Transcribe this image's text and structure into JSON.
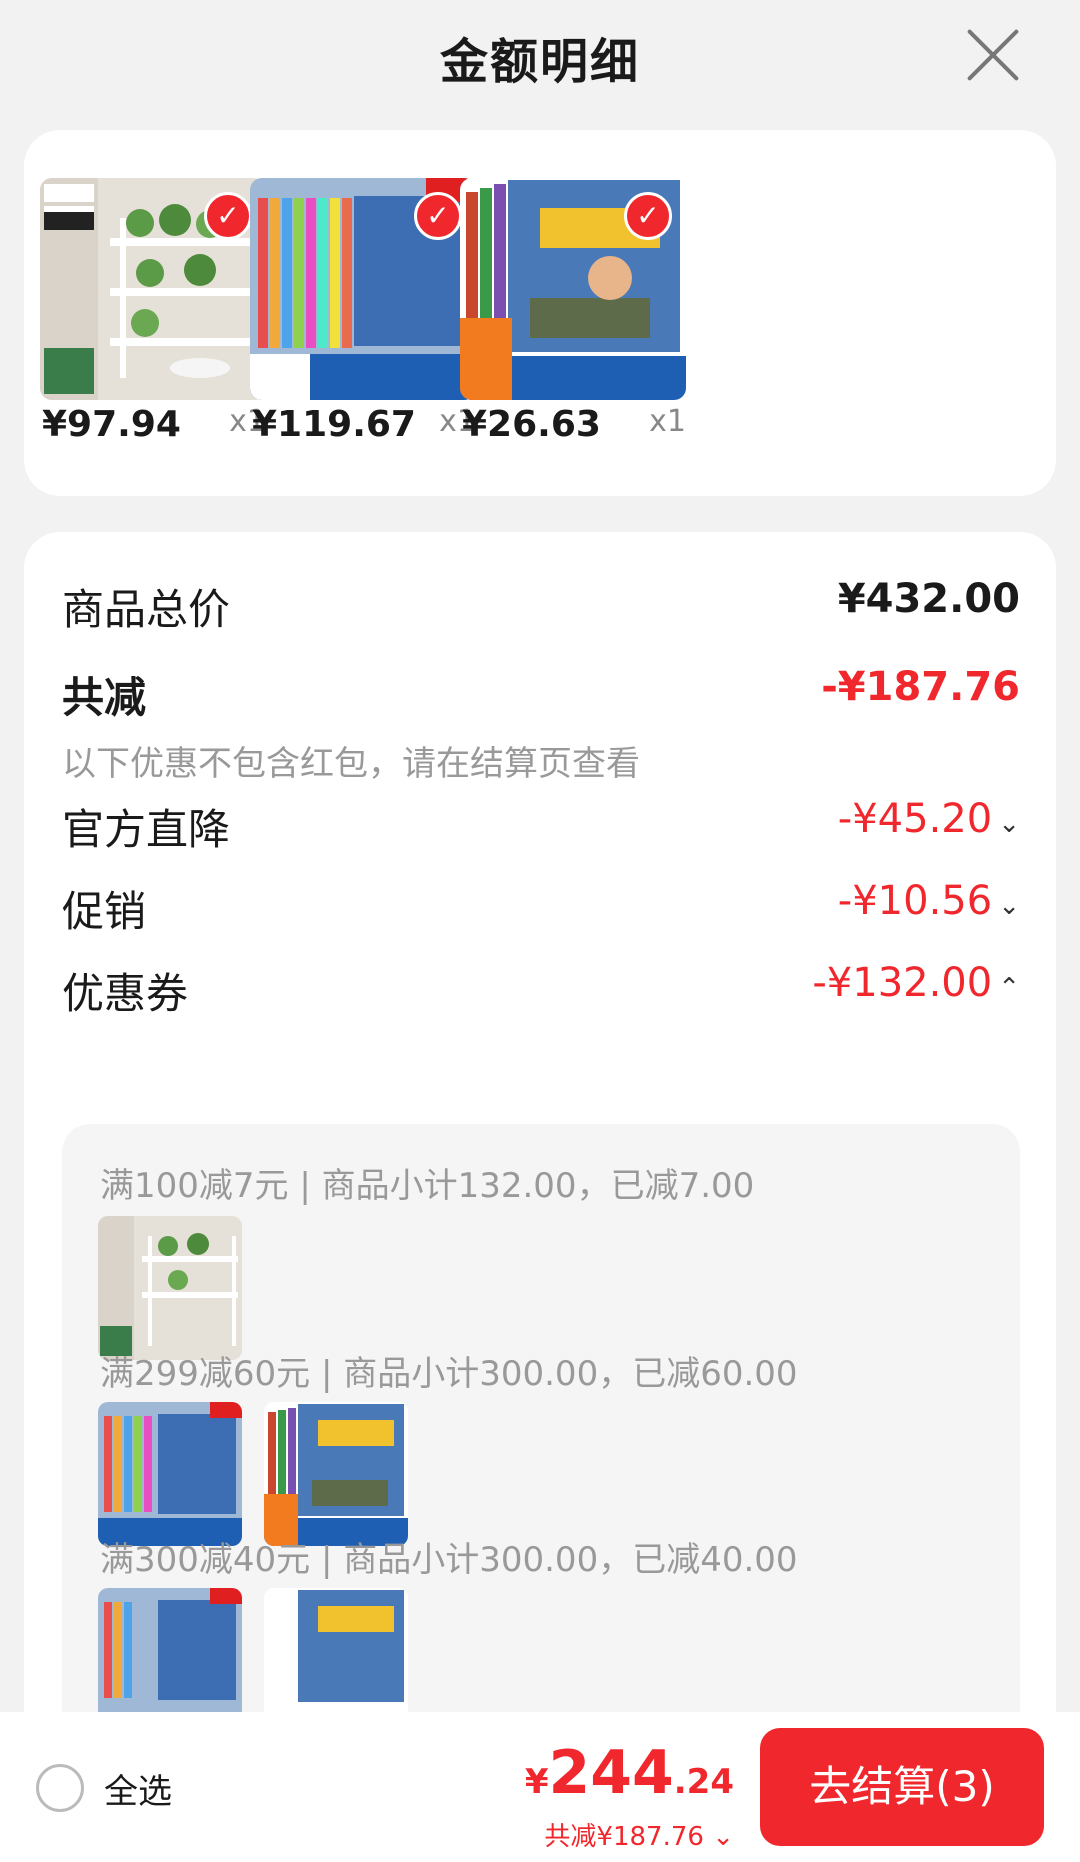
{
  "header": {
    "title": "金额明细"
  },
  "goods": [
    {
      "price": "¥97.94",
      "qty": "x1",
      "icon": "shelf-product-image"
    },
    {
      "price": "¥119.67",
      "qty": "x1",
      "icon": "book-set-product-image"
    },
    {
      "price": "¥26.63",
      "qty": "x1",
      "icon": "book-set-product-image"
    }
  ],
  "summary": {
    "total_label": "商品总价",
    "total_value": "¥432.00",
    "discount_label": "共减",
    "discount_value": "-¥187.76",
    "note": "以下优惠不包含红包，请在结算页查看",
    "items": [
      {
        "label": "官方直降",
        "value": "-¥45.20",
        "chevron": "⌄"
      },
      {
        "label": "促销",
        "value": "-¥10.56",
        "chevron": "⌄"
      },
      {
        "label": "优惠券",
        "value": "-¥132.00",
        "chevron": "⌃"
      }
    ]
  },
  "coupons": [
    {
      "text": "满100减7元 | 商品小计132.00，已减7.00"
    },
    {
      "text": "满299减60元 | 商品小计300.00，已减60.00"
    },
    {
      "text": "满300减40元 | 商品小计300.00，已减40.00"
    }
  ],
  "footer": {
    "select_all": "全选",
    "yen": "¥",
    "total_int": "244",
    "total_dec": ".24",
    "saved": "共减¥187.76 ⌄",
    "checkout": "去结算(3)"
  },
  "colors": {
    "accent": "#f0282d"
  }
}
